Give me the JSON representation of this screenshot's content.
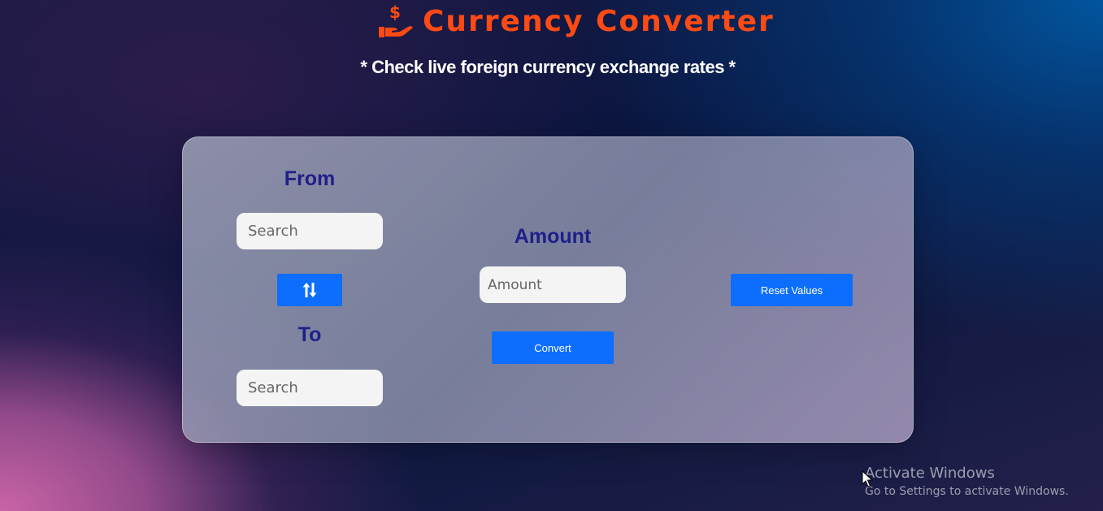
{
  "header": {
    "title": "Currency Converter",
    "subtitle": "* Check live foreign currency exchange rates *",
    "logo_icon": "hand-holding-dollar-icon",
    "title_color": "#ff4b13"
  },
  "converter": {
    "from_label": "From",
    "from_placeholder": "Search",
    "swap_icon": "swap-vertical-arrows-icon",
    "to_label": "To",
    "to_placeholder": "Search",
    "amount_label": "Amount",
    "amount_placeholder": "Amount",
    "convert_button": "Convert",
    "reset_button": "Reset Values",
    "label_color": "#1f1f8a",
    "button_color": "#0d6efd"
  },
  "os_watermark": {
    "title": "Activate Windows",
    "subtitle": "Go to Settings to activate Windows."
  }
}
